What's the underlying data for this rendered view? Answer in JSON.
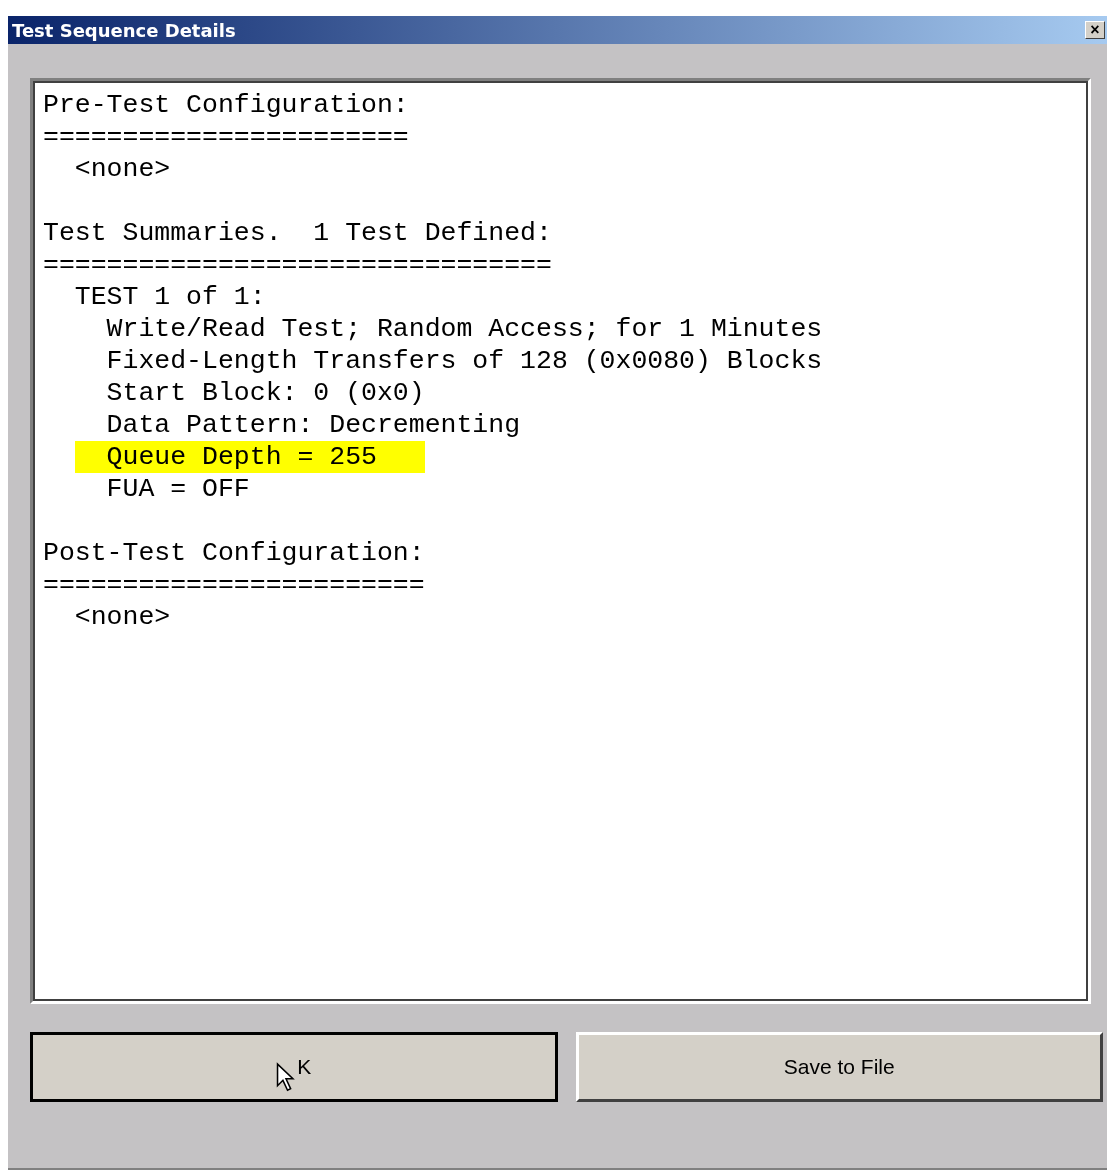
{
  "window": {
    "title": "Test Sequence Details",
    "close": "×"
  },
  "report": {
    "sections": [
      {
        "heading": "Pre-Test Configuration:",
        "rule": "=======================",
        "lines": [
          {
            "text": "  <none>",
            "highlighted": false
          }
        ]
      },
      {
        "heading": "Test Summaries.  1 Test Defined:",
        "rule": "================================",
        "lines": [
          {
            "text": "  TEST 1 of 1:",
            "highlighted": false
          },
          {
            "text": "    Write/Read Test; Random Access; for 1 Minutes",
            "highlighted": false
          },
          {
            "text": "    Fixed-Length Transfers of 128 (0x0080) Blocks",
            "highlighted": false
          },
          {
            "text": "    Start Block: 0 (0x0)",
            "highlighted": false
          },
          {
            "text": "    Data Pattern: Decrementing",
            "highlighted": false
          },
          {
            "text": "    Queue Depth = 255",
            "highlighted": true
          },
          {
            "text": "    FUA = OFF",
            "highlighted": false
          }
        ]
      },
      {
        "heading": "Post-Test Configuration:",
        "rule": "========================",
        "lines": [
          {
            "text": "  <none>",
            "highlighted": false
          }
        ]
      }
    ]
  },
  "buttons": [
    {
      "label": "K",
      "default": true
    },
    {
      "label": "Save to File",
      "default": false
    }
  ]
}
